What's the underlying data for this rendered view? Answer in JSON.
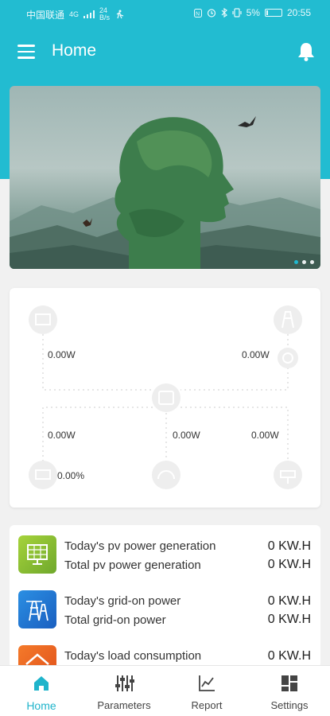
{
  "statusbar": {
    "carrier": "中国联通",
    "network": "4G",
    "speed_top": "24",
    "speed_bottom": "B/s",
    "battery": "5%",
    "time": "20:55"
  },
  "appbar": {
    "title": "Home",
    "menu_icon": "menu-icon",
    "bell_icon": "bell-icon"
  },
  "banner": {
    "slides": 3,
    "active_index": 0
  },
  "energy_flow": {
    "pv_power": "0.00W",
    "grid_power": "0.00W",
    "battery_power": "0.00W",
    "inverter_power": "0.00W",
    "load_power": "0.00W",
    "battery_soc": "0.00%"
  },
  "stats": [
    {
      "icon": "solar-panel-icon",
      "color": "#8dc63f",
      "label_today": "Today's pv power generation",
      "label_total": "Total pv power generation",
      "value_today": "0  KW.H",
      "value_total": "0  KW.H"
    },
    {
      "icon": "grid-tower-icon",
      "color": "#1f6fd1",
      "label_today": "Today's grid-on power",
      "label_total": "Total grid-on power",
      "value_today": "0  KW.H",
      "value_total": "0  KW.H"
    },
    {
      "icon": "home-load-icon",
      "color": "#f26522",
      "label_today": "Today's load consumption",
      "label_total": "",
      "value_today": "0  KW.H",
      "value_total": ""
    }
  ],
  "nav": {
    "home": "Home",
    "parameters": "Parameters",
    "report": "Report",
    "settings": "Settings",
    "active": "home",
    "accent": "#1fb4cb"
  }
}
